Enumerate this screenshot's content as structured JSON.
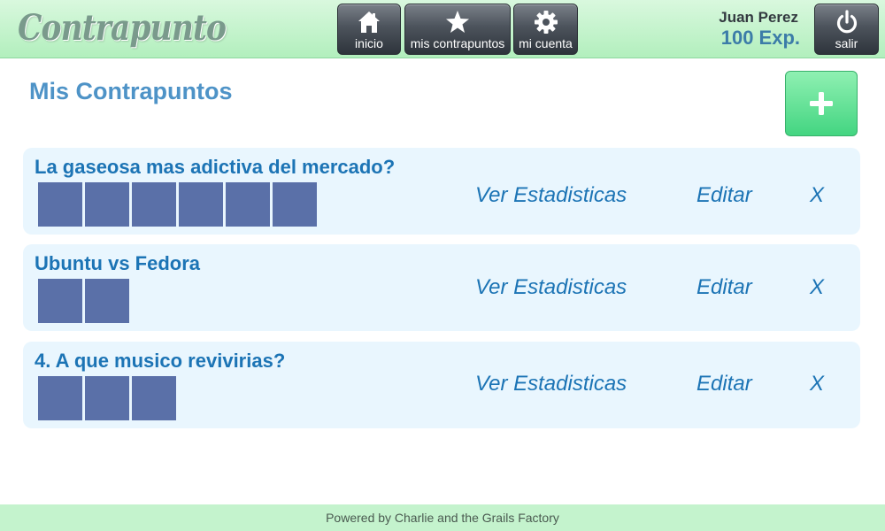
{
  "header": {
    "logo": "Contrapunto",
    "nav": [
      {
        "label": "inicio",
        "icon": "home-icon"
      },
      {
        "label": "mis contrapuntos",
        "icon": "star-icon"
      },
      {
        "label": "mi cuenta",
        "icon": "gear-icon"
      }
    ],
    "user": {
      "name": "Juan Perez",
      "exp": "100 Exp."
    },
    "logout": {
      "label": "salir",
      "icon": "power-icon"
    }
  },
  "main": {
    "title": "Mis Contrapuntos",
    "add_button": {
      "icon": "plus-icon"
    },
    "items": [
      {
        "title": "La gaseosa mas adictiva del mercado?",
        "squares": 6,
        "stats": "Ver Estadisticas",
        "edit": "Editar",
        "delete": "X"
      },
      {
        "title": "Ubuntu vs Fedora",
        "squares": 2,
        "stats": "Ver Estadisticas",
        "edit": "Editar",
        "delete": "X"
      },
      {
        "title": "4. A que musico revivirias?",
        "squares": 3,
        "stats": "Ver Estadisticas",
        "edit": "Editar",
        "delete": "X"
      }
    ]
  },
  "footer": {
    "text": "Powered by Charlie and the Grails Factory"
  },
  "colors": {
    "header_bg": "#b2efbd",
    "accent": "#4e93c7",
    "link": "#1c74b5",
    "card_bg": "#e9f6fe",
    "square": "#5a70a8",
    "add": "#43d581"
  }
}
